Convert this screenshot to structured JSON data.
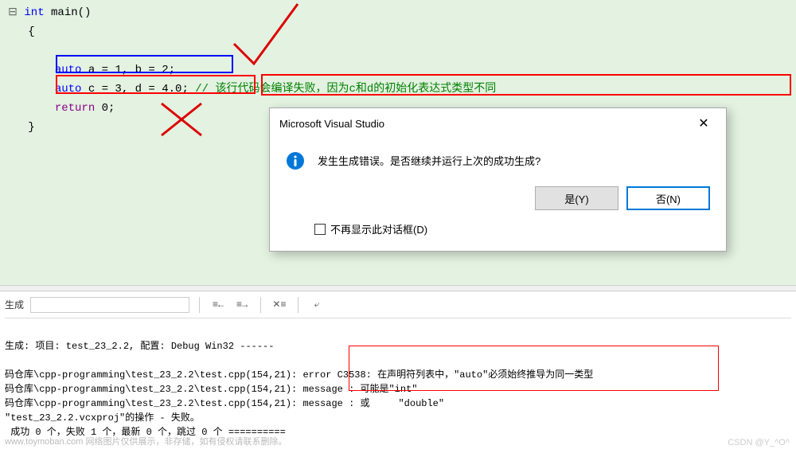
{
  "code": {
    "line1_kw": "int",
    "line1_rest": " main()",
    "line2": "{",
    "line3_kw": "auto",
    "line3_rest": " a = 1, b = 2;",
    "line4_kw": "auto",
    "line4_rest": " c = 3, d = 4.0;",
    "line4_comment": "// 该行代码会编译失败，因为c和d的初始化表达式类型不同",
    "line5_kw": "return",
    "line5_rest": " 0;",
    "line6": "}"
  },
  "dialog": {
    "title": "Microsoft Visual Studio",
    "message": "发生生成错误。是否继续并运行上次的成功生成?",
    "yes": "是(Y)",
    "no": "否(N)",
    "checkbox_label": "不再显示此对话框(D)"
  },
  "output": {
    "header_label": "生成",
    "line1": "生成: 项目: test_23_2.2, 配置: Debug Win32 ------",
    "line2": "码仓库\\cpp-programming\\test_23_2.2\\test.cpp(154,21): error C3538: 在声明符列表中，\"auto\"必须始终推导为同一类型",
    "line3": "码仓库\\cpp-programming\\test_23_2.2\\test.cpp(154,21): message : 可能是\"int\"",
    "line4": "码仓库\\cpp-programming\\test_23_2.2\\test.cpp(154,21): message : 或     \"double\"",
    "line5": "\"test_23_2.2.vcxproj\"的操作 - 失败。",
    "line6": " 成功 0 个，失败 1 个，最新 0 个，跳过 0 个 =========="
  },
  "watermarks": {
    "left": "www.toymoban.com 网络图片仅供展示，非存储，如有侵权请联系删除。",
    "right": "CSDN @Y_^O^"
  }
}
